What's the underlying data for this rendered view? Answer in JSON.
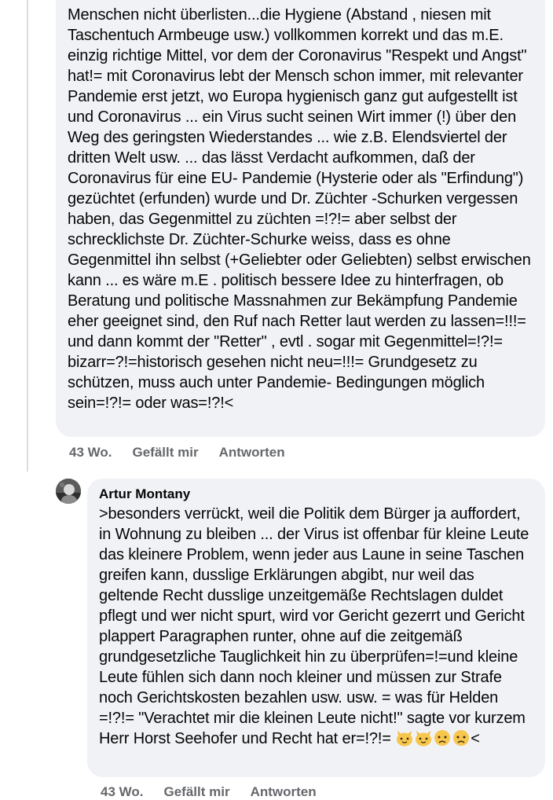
{
  "comment_1": {
    "text": "Menschen nicht überlisten...die Hygiene (Abstand , niesen mit Taschentuch Armbeuge usw.) vollkommen korrekt und das m.E. einzig richtige Mittel, vor dem der Coronavirus \"Respekt und Angst\" hat!= mit Coronavirus lebt der Mensch schon immer, mit relevanter Pandemie erst jetzt, wo Europa hygienisch ganz gut aufgestellt ist und Coronavirus ... ein Virus sucht seinen Wirt immer (!) über den Weg des geringsten Wiederstandes ... wie z.B. Elendsviertel der dritten Welt usw. ... das lässt Verdacht aufkommen, daß der Coronavirus für eine EU- Pandemie (Hysterie oder als \"Erfindung\") gezüchtet (erfunden) wurde und  Dr. Züchter -Schurken vergessen haben, das Gegenmittel zu züchten =!?!= aber selbst der schrecklichste Dr. Züchter-Schurke weiss, dass es ohne Gegenmittel ihn selbst (+Geliebter oder Geliebten) selbst erwischen kann ... es wäre m.E . politisch bessere Idee zu hinterfragen, ob Beratung und politische Massnahmen zur Bekämpfung Pandemie eher geeignet sind, den Ruf nach Retter laut werden zu lassen=!!!= und dann kommt der \"Retter\" , evtl . sogar mit Gegenmittel=!?!= bizarr=?!=historisch gesehen nicht neu=!!!= Grundgesetz zu schützen, muss auch unter Pandemie- Bedingungen möglich sein=!?!= oder was=!?!<",
    "time": "43 Wo.",
    "like_label": "Gefällt mir",
    "reply_label": "Antworten"
  },
  "comment_2": {
    "author": "Artur Montany",
    "text": ">besonders verrückt, weil die Politik dem Bürger ja auffordert, in Wohnung zu bleiben ... der Virus ist offenbar für  kleine Leute das kleinere Problem, wenn jeder aus Laune in seine Taschen greifen kann, dusslige Erklärungen abgibt, nur weil das geltende Recht dusslige unzeitgemäße Rechtslagen duldet pflegt und wer nicht spurt, wird vor Gericht gezerrt und Gericht plappert Paragraphen runter, ohne auf die zeitgemäß grundgesetzliche Tauglichkeit hin zu überprüfen=!=und kleine Leute fühlen sich dann noch kleiner und müssen zur Strafe noch Gerichtskosten bezahlen usw. usw. = was für Helden =!?!= \"Verachtet mir die kleinen Leute nicht!\" sagte vor kurzem Herr Horst Seehofer und Recht hat er=!?!= ",
    "text_end": "<",
    "emojis": [
      "cat-face-emoji",
      "cat-face-emoji",
      "worried-face-emoji",
      "worried-face-emoji"
    ],
    "time": "43 Wo.",
    "like_label": "Gefällt mir",
    "reply_label": "Antworten"
  },
  "colors": {
    "bubble": "#f0f2f5",
    "meta_text": "#65676b",
    "body_text": "#050505",
    "thread_line": "#dadde1"
  }
}
